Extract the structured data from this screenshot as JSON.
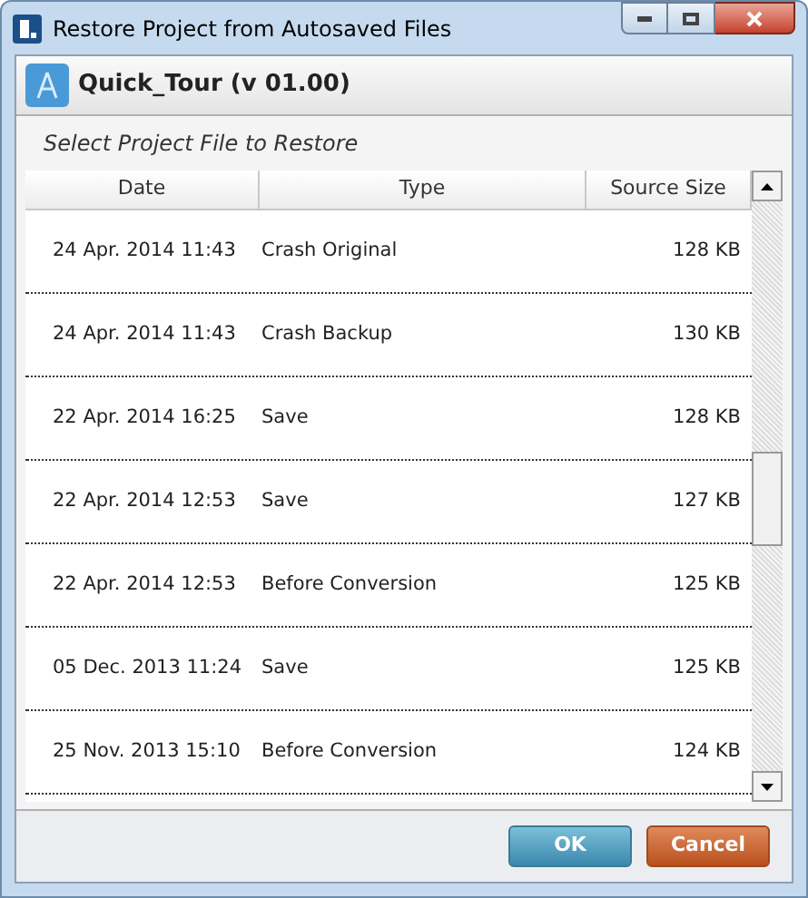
{
  "window": {
    "title": "Restore Project from Autosaved Files"
  },
  "project": {
    "title": "Quick_Tour (v 01.00)"
  },
  "subtitle": "Select Project File to Restore",
  "table": {
    "columns": [
      "Date",
      "Type",
      "Source Size"
    ],
    "rows": [
      {
        "date": "24 Apr. 2014 11:43",
        "type": "Crash Original",
        "size": "128 KB"
      },
      {
        "date": "24 Apr. 2014 11:43",
        "type": "Crash Backup",
        "size": "130 KB"
      },
      {
        "date": "22 Apr. 2014 16:25",
        "type": "Save",
        "size": "128 KB"
      },
      {
        "date": "22 Apr. 2014 12:53",
        "type": "Save",
        "size": "127 KB"
      },
      {
        "date": "22 Apr. 2014 12:53",
        "type": "Before Conversion",
        "size": "125 KB"
      },
      {
        "date": "05 Dec. 2013 11:24",
        "type": "Save",
        "size": "125 KB"
      },
      {
        "date": "25 Nov. 2013 15:10",
        "type": "Before Conversion",
        "size": "124 KB"
      }
    ]
  },
  "buttons": [
    {
      "label": "OK",
      "kind": "primary"
    },
    {
      "label": "Cancel",
      "kind": "cancel"
    }
  ]
}
